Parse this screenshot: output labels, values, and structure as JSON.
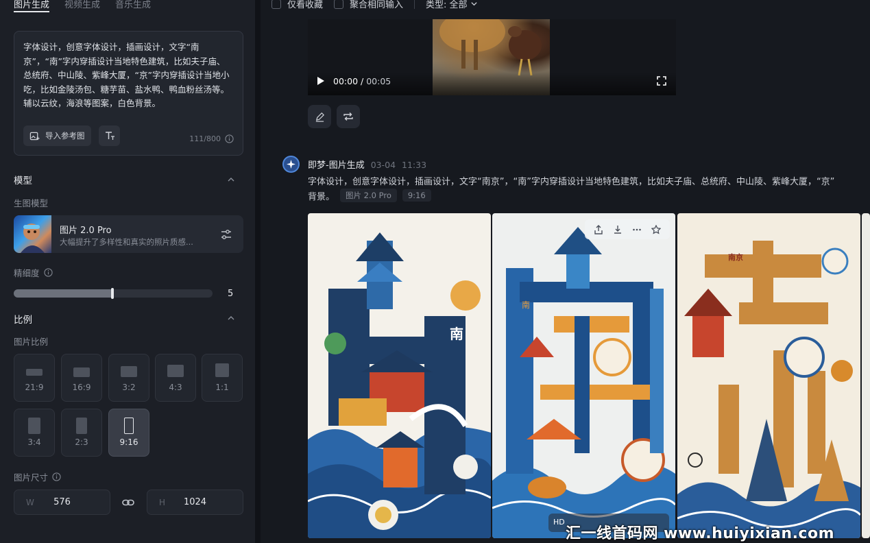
{
  "tabs": [
    {
      "label": "图片生成",
      "active": true
    },
    {
      "label": "视频生成",
      "active": false
    },
    {
      "label": "音乐生成",
      "active": false
    }
  ],
  "prompt": {
    "text": "字体设计，创意字体设计，插画设计，文字“南京”，“南”字内穿插设计当地特色建筑，比如夫子庙、总统府、中山陵、紫峰大厦，“京”字内穿插设计当地小吃，比如金陵汤包、糖芋苗、盐水鸭、鸭血粉丝汤等。辅以云纹，海浪等图案，白色背景。",
    "ref_button": "导入参考图",
    "counter": "111/800"
  },
  "model_section": {
    "title": "模型",
    "sub_label": "生图模型",
    "model_name": "图片 2.0 Pro",
    "model_desc": "大幅提升了多样性和真实的照片质感..."
  },
  "detail": {
    "label": "精细度",
    "value": "5",
    "fraction": 0.5
  },
  "ratio_section": {
    "title": "比例",
    "sub_label": "图片比例",
    "ratios": [
      "21:9",
      "16:9",
      "3:2",
      "4:3",
      "1:1",
      "3:4",
      "2:3",
      "9:16"
    ],
    "selected": "9:16"
  },
  "size_section": {
    "label": "图片尺寸",
    "w_tag": "W",
    "w_value": "576",
    "h_tag": "H",
    "h_value": "1024"
  },
  "filters": {
    "only_fav": "仅看收藏",
    "merge_same": "聚合相同输入",
    "type": "类型: 全部"
  },
  "video": {
    "current": "00:00",
    "separator": "/",
    "duration": "00:05"
  },
  "generation": {
    "source": "即梦-图片生成",
    "date": "03-04",
    "time": "11:33",
    "prompt_line1": "字体设计，创意字体设计，插画设计，文字“南京”，“南”字内穿插设计当地特色建筑，比如夫子庙、总统府、中山陵、紫峰大厦，“京”",
    "prompt_line2": "背景。",
    "chip_model": "图片 2.0 Pro",
    "chip_ratio": "9:16",
    "image_chars": [
      "南",
      "南",
      "南京"
    ],
    "hd_label": "HD"
  },
  "watermark": "汇一线首码网 www.huiyixian.com",
  "colors": {
    "bg": "#16191f",
    "panel": "#1c1f26",
    "accent": "#4f86d8"
  }
}
